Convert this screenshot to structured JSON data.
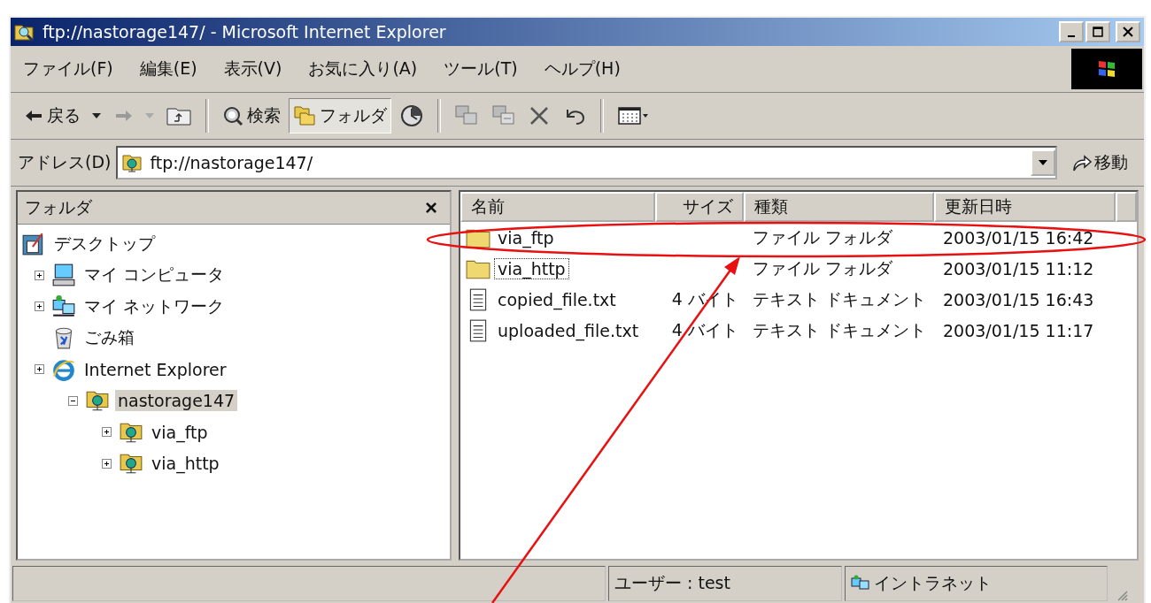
{
  "window": {
    "title": "ftp://nastorage147/ - Microsoft Internet Explorer"
  },
  "menu": [
    "ファイル(F)",
    "編集(E)",
    "表示(V)",
    "お気に入り(A)",
    "ツール(T)",
    "ヘルプ(H)"
  ],
  "toolbar": {
    "back": {
      "label": "戻る",
      "disabled": false
    },
    "forward": {
      "disabled": true
    },
    "search": {
      "label": "検索",
      "pressed": false
    },
    "folders": {
      "label": "フォルダ",
      "pressed": true
    }
  },
  "address": {
    "label": "アドレス(D)",
    "value": "ftp://nastorage147/",
    "go": "移動"
  },
  "folder_pane": {
    "title": "フォルダ",
    "close": "×",
    "tree": [
      {
        "label": "デスクトップ",
        "selected": false,
        "children": [
          {
            "label": "マイ コンピュータ",
            "expanded": false,
            "selected": false
          },
          {
            "label": "マイ ネットワーク",
            "expanded": false,
            "selected": false
          },
          {
            "label": "ごみ箱",
            "selected": false
          },
          {
            "label": "Internet Explorer",
            "expanded": false,
            "selected": false,
            "children": [
              {
                "label": "nastorage147",
                "expanded": true,
                "selected": true,
                "children": [
                  {
                    "label": "via_ftp",
                    "expanded": false,
                    "selected": false
                  },
                  {
                    "label": "via_http",
                    "expanded": false,
                    "selected": false
                  }
                ]
              }
            ]
          }
        ]
      }
    ]
  },
  "file_list": {
    "columns": [
      "名前",
      "サイズ",
      "種類",
      "更新日時"
    ],
    "rows": [
      {
        "kind": "folder",
        "name": "via_ftp",
        "size": "",
        "type": "ファイル フォルダ",
        "modified": "2003/01/15 16:42",
        "focused": false
      },
      {
        "kind": "folder",
        "name": "via_http",
        "size": "",
        "type": "ファイル フォルダ",
        "modified": "2003/01/15 11:12",
        "focused": true
      },
      {
        "kind": "text",
        "name": "copied_file.txt",
        "size": "4 バイト",
        "type": "テキスト ドキュメント",
        "modified": "2003/01/15 16:43",
        "focused": false
      },
      {
        "kind": "text",
        "name": "uploaded_file.txt",
        "size": "4 バイト",
        "type": "テキスト ドキュメント",
        "modified": "2003/01/15 11:17",
        "focused": false
      }
    ]
  },
  "status_bar": {
    "user": "ユーザー : test",
    "zone": "イントラネット"
  }
}
